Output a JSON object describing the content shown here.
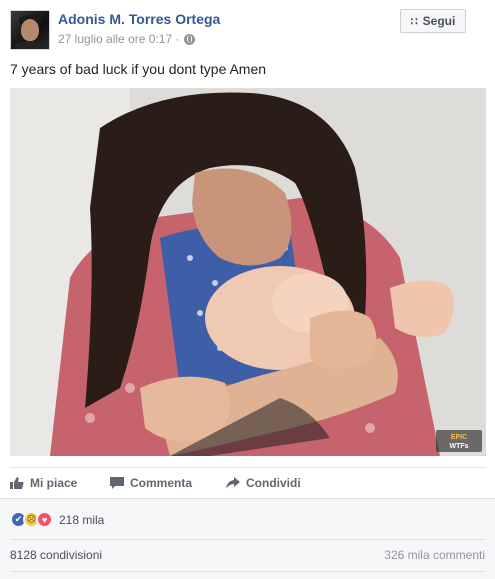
{
  "post": {
    "author": "Adonis M. Torres Ortega",
    "timestamp": "27 luglio alle ore 0:17 ·",
    "privacy_icon": "globe-icon",
    "follow_label": "Segui",
    "follow_icon": "rss-icon",
    "text": "7 years of bad luck if you dont type Amen",
    "image_watermark": "EPIC WTFs"
  },
  "actions": {
    "like_label": "Mi piace",
    "comment_label": "Commenta",
    "share_label": "Condividi"
  },
  "feedback": {
    "reaction_icons": [
      "like-icon",
      "sad-icon",
      "love-icon"
    ],
    "reaction_count": "218 mila",
    "shares": "8128 condivisioni",
    "comments": "326 mila commenti"
  },
  "colors": {
    "link": "#365899",
    "like": "#4267b2",
    "love": "#f25268",
    "sad": "#f7c84b",
    "background": "#f6f7f9"
  }
}
